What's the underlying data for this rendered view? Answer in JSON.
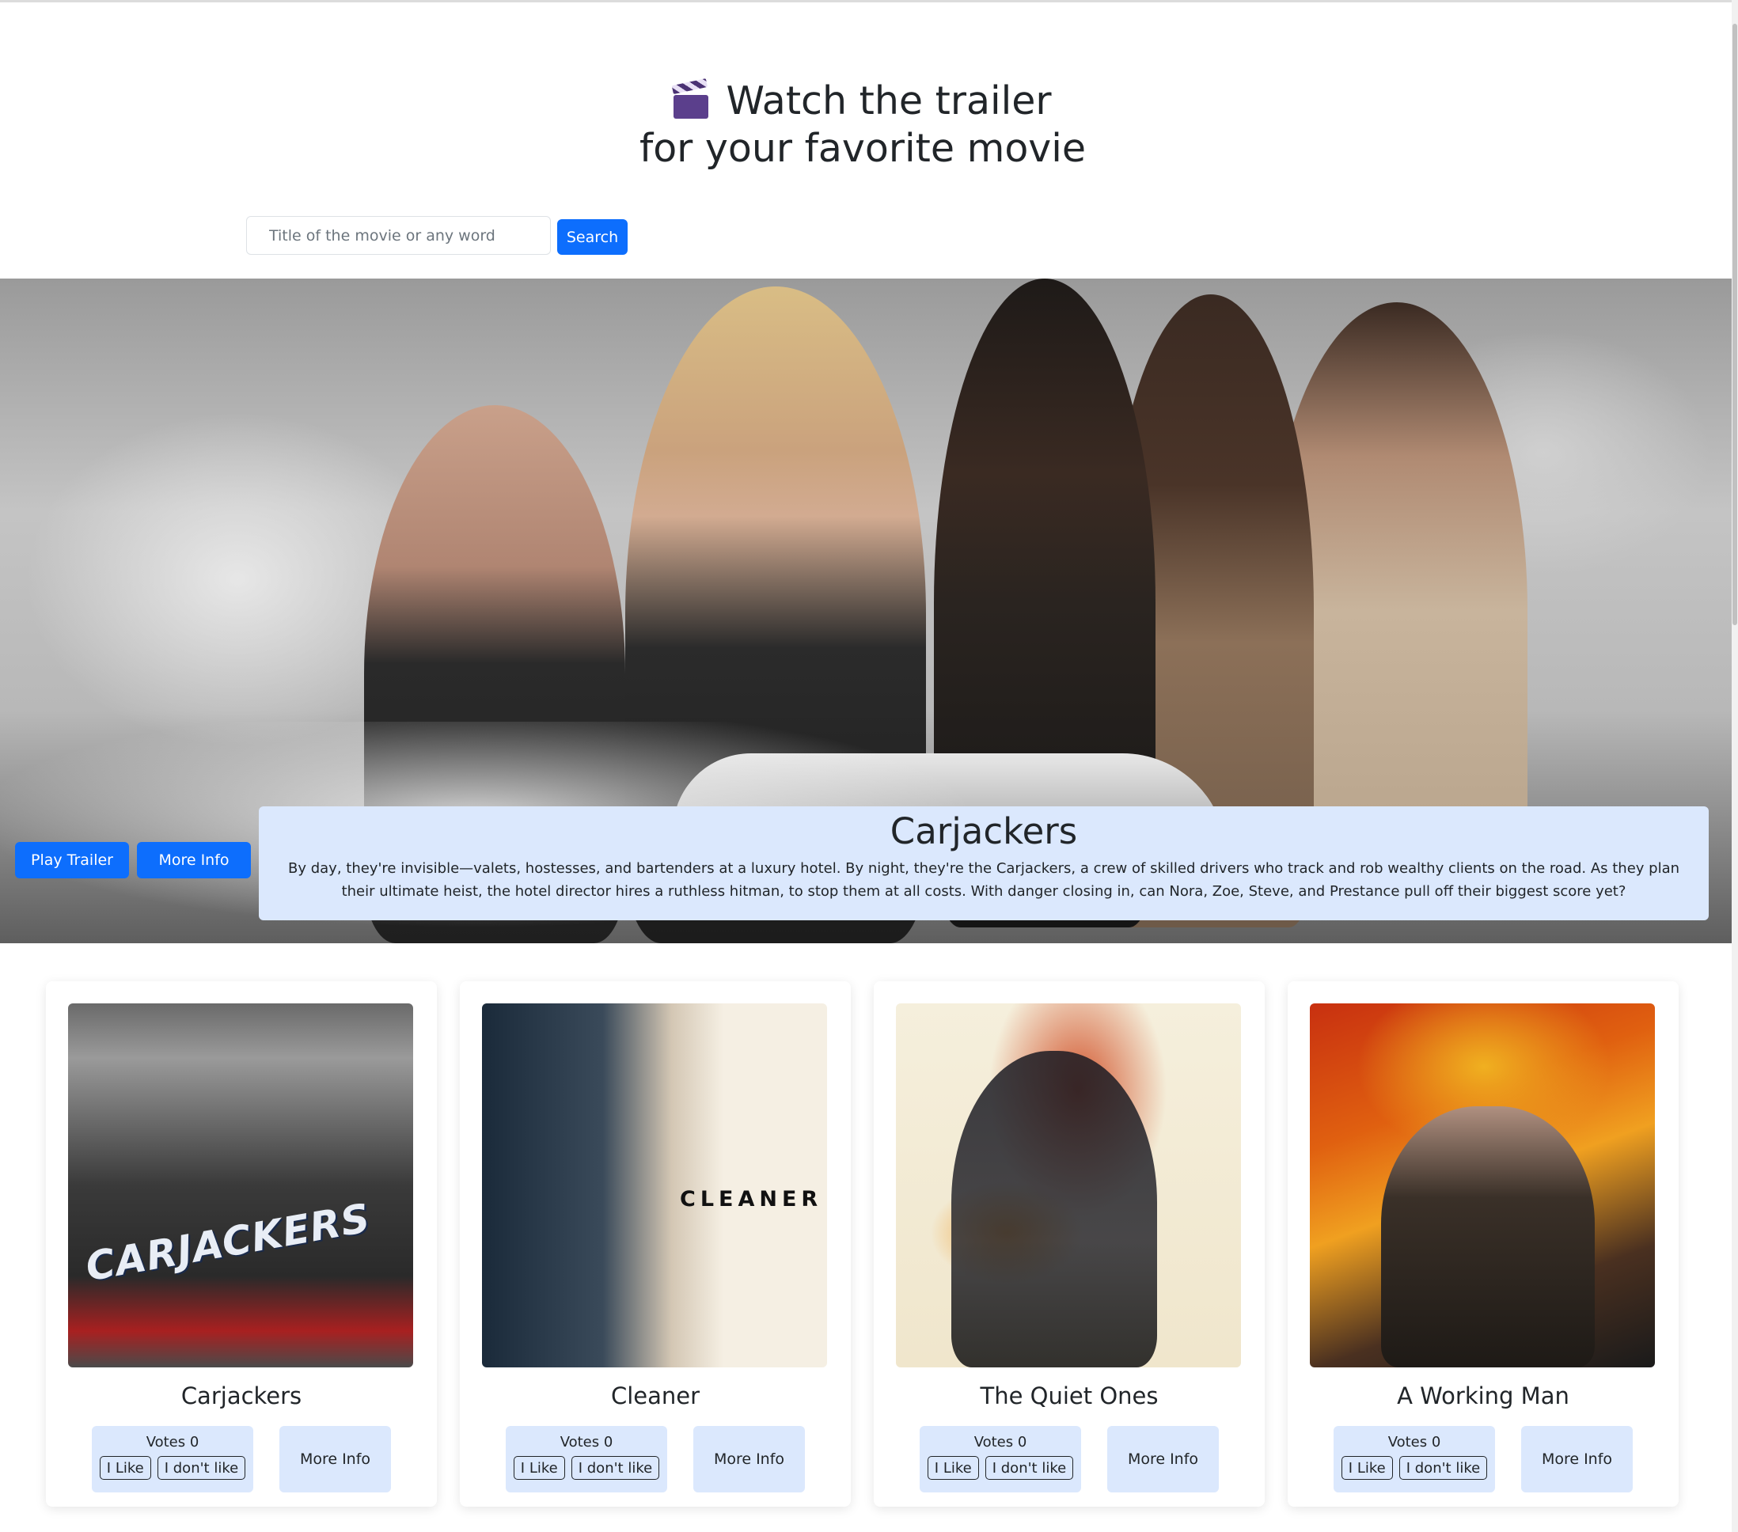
{
  "header": {
    "title_line1": "Watch the trailer",
    "title_line2": "for your favorite movie",
    "icon": "clapper-board-icon"
  },
  "search": {
    "placeholder": "Title of the movie or any word",
    "button_label": "Search"
  },
  "hero": {
    "title": "Carjackers",
    "description": "By day, they're invisible—valets, hostesses, and bartenders at a luxury hotel. By night, they're the Carjackers, a crew of skilled drivers who track and rob wealthy clients on the road. As they plan their ultimate heist, the hotel director hires a ruthless hitman, to stop them at all costs. With danger closing in, can Nora, Zoe, Steve, and Prestance pull off their biggest score yet?",
    "play_label": "Play Trailer",
    "more_label": "More Info"
  },
  "movies": [
    {
      "title": "Carjackers",
      "votes": "Votes 0",
      "like": "I Like",
      "dislike": "I don't like",
      "more": "More Info",
      "poster_text": "CARJACKERS"
    },
    {
      "title": "Cleaner",
      "votes": "Votes 0",
      "like": "I Like",
      "dislike": "I don't like",
      "more": "More Info",
      "poster_text": "CLEANER"
    },
    {
      "title": "The Quiet Ones",
      "votes": "Votes 0",
      "like": "I Like",
      "dislike": "I don't like",
      "more": "More Info"
    },
    {
      "title": "A Working Man",
      "votes": "Votes 0",
      "like": "I Like",
      "dislike": "I don't like",
      "more": "More Info"
    }
  ],
  "colors": {
    "primary": "#0d6efd",
    "info_bg": "#dbe8fd"
  }
}
